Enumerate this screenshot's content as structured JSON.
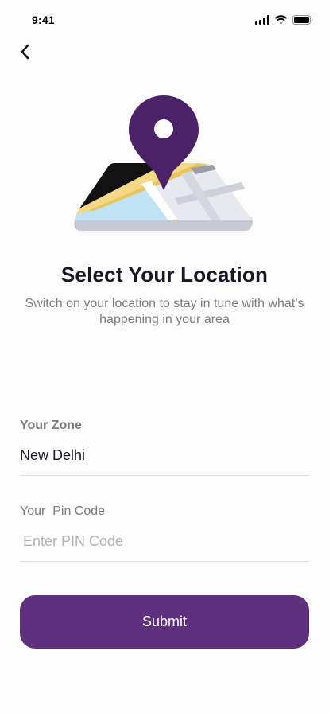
{
  "status_bar": {
    "time": "9:41",
    "icons": [
      "cellular-signal-icon",
      "wifi-icon",
      "battery-icon"
    ]
  },
  "navigation": {
    "back_icon": "chevron-left-icon"
  },
  "illustration": {
    "icon": "map-location-pin-icon",
    "pin_color": "#4b2267"
  },
  "header": {
    "title": "Select Your Location",
    "subtitle": "Switch on your location to stay in tune with what’s happening in your area"
  },
  "form": {
    "zone": {
      "label": "Your Zone",
      "value": "New Delhi"
    },
    "pin_code": {
      "label": "Your  Pin Code",
      "value": "",
      "placeholder": "Enter PIN Code"
    }
  },
  "actions": {
    "submit_label": "Submit"
  },
  "colors": {
    "accent": "#5e307e",
    "text_primary": "#181725",
    "text_secondary": "#7c7c7c"
  }
}
